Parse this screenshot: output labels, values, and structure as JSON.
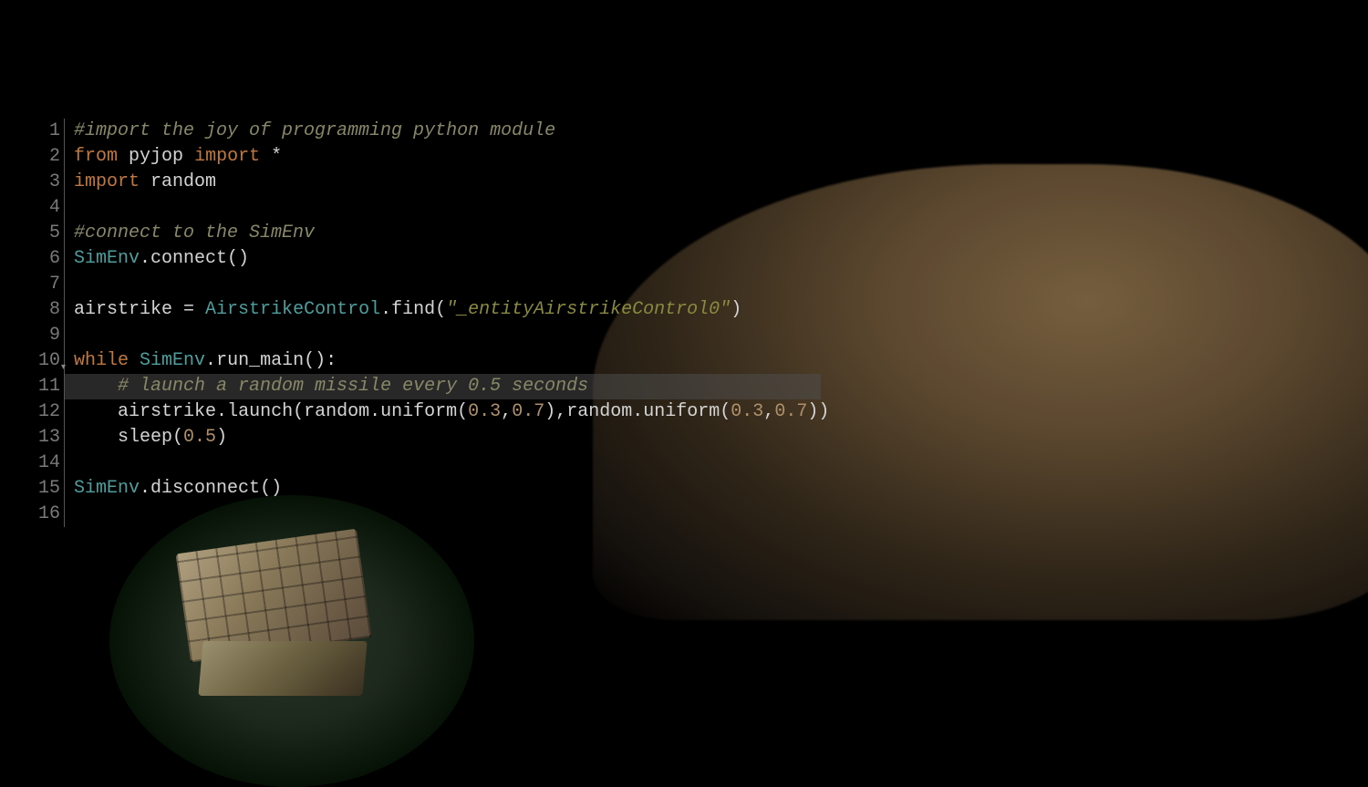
{
  "editor": {
    "lines": [
      {
        "num": "1",
        "tokens": [
          {
            "t": "#import the joy of programming python module",
            "c": "tok-comment"
          }
        ]
      },
      {
        "num": "2",
        "tokens": [
          {
            "t": "from",
            "c": "tok-keyword"
          },
          {
            "t": " ",
            "c": ""
          },
          {
            "t": "pyjop",
            "c": "tok-module"
          },
          {
            "t": " ",
            "c": ""
          },
          {
            "t": "import",
            "c": "tok-keyword"
          },
          {
            "t": " ",
            "c": ""
          },
          {
            "t": "*",
            "c": "tok-punct"
          }
        ]
      },
      {
        "num": "3",
        "tokens": [
          {
            "t": "import",
            "c": "tok-keyword"
          },
          {
            "t": " ",
            "c": ""
          },
          {
            "t": "random",
            "c": "tok-module"
          }
        ]
      },
      {
        "num": "4",
        "tokens": []
      },
      {
        "num": "5",
        "tokens": [
          {
            "t": "#connect to the SimEnv",
            "c": "tok-comment"
          }
        ]
      },
      {
        "num": "6",
        "tokens": [
          {
            "t": "SimEnv",
            "c": "tok-class"
          },
          {
            "t": ".",
            "c": "tok-punct"
          },
          {
            "t": "connect",
            "c": "tok-function"
          },
          {
            "t": "()",
            "c": "tok-punct"
          }
        ]
      },
      {
        "num": "7",
        "tokens": []
      },
      {
        "num": "8",
        "tokens": [
          {
            "t": "airstrike",
            "c": "tok-module"
          },
          {
            "t": " = ",
            "c": "tok-punct"
          },
          {
            "t": "AirstrikeControl",
            "c": "tok-class"
          },
          {
            "t": ".",
            "c": "tok-punct"
          },
          {
            "t": "find",
            "c": "tok-function"
          },
          {
            "t": "(",
            "c": "tok-punct"
          },
          {
            "t": "\"_entityAirstrikeControl0\"",
            "c": "tok-string"
          },
          {
            "t": ")",
            "c": "tok-punct"
          }
        ]
      },
      {
        "num": "9",
        "tokens": []
      },
      {
        "num": "10",
        "caret": true,
        "tokens": [
          {
            "t": "while",
            "c": "tok-keyword"
          },
          {
            "t": " ",
            "c": ""
          },
          {
            "t": "SimEnv",
            "c": "tok-class"
          },
          {
            "t": ".",
            "c": "tok-punct"
          },
          {
            "t": "run_main",
            "c": "tok-function"
          },
          {
            "t": "():",
            "c": "tok-punct"
          }
        ]
      },
      {
        "num": "11",
        "highlight": true,
        "tokens": [
          {
            "t": "    ",
            "c": ""
          },
          {
            "t": "# launch a random missile every 0.5 seconds",
            "c": "tok-comment"
          }
        ]
      },
      {
        "num": "12",
        "tokens": [
          {
            "t": "    ",
            "c": ""
          },
          {
            "t": "airstrike",
            "c": "tok-module"
          },
          {
            "t": ".",
            "c": "tok-punct"
          },
          {
            "t": "launch",
            "c": "tok-function"
          },
          {
            "t": "(",
            "c": "tok-punct"
          },
          {
            "t": "random",
            "c": "tok-module"
          },
          {
            "t": ".",
            "c": "tok-punct"
          },
          {
            "t": "uniform",
            "c": "tok-function"
          },
          {
            "t": "(",
            "c": "tok-punct"
          },
          {
            "t": "0.3",
            "c": "tok-number"
          },
          {
            "t": ",",
            "c": "tok-punct"
          },
          {
            "t": "0.7",
            "c": "tok-number"
          },
          {
            "t": "),",
            "c": "tok-punct"
          },
          {
            "t": "random",
            "c": "tok-module"
          },
          {
            "t": ".",
            "c": "tok-punct"
          },
          {
            "t": "uniform",
            "c": "tok-function"
          },
          {
            "t": "(",
            "c": "tok-punct"
          },
          {
            "t": "0.3",
            "c": "tok-number"
          },
          {
            "t": ",",
            "c": "tok-punct"
          },
          {
            "t": "0.7",
            "c": "tok-number"
          },
          {
            "t": "))",
            "c": "tok-punct"
          }
        ]
      },
      {
        "num": "13",
        "tokens": [
          {
            "t": "    ",
            "c": ""
          },
          {
            "t": "sleep",
            "c": "tok-function"
          },
          {
            "t": "(",
            "c": "tok-punct"
          },
          {
            "t": "0.5",
            "c": "tok-number"
          },
          {
            "t": ")",
            "c": "tok-punct"
          }
        ]
      },
      {
        "num": "14",
        "tokens": []
      },
      {
        "num": "15",
        "tokens": [
          {
            "t": "SimEnv",
            "c": "tok-class"
          },
          {
            "t": ".",
            "c": "tok-punct"
          },
          {
            "t": "disconnect",
            "c": "tok-function"
          },
          {
            "t": "()",
            "c": "tok-punct"
          }
        ]
      },
      {
        "num": "16",
        "tokens": []
      }
    ]
  }
}
